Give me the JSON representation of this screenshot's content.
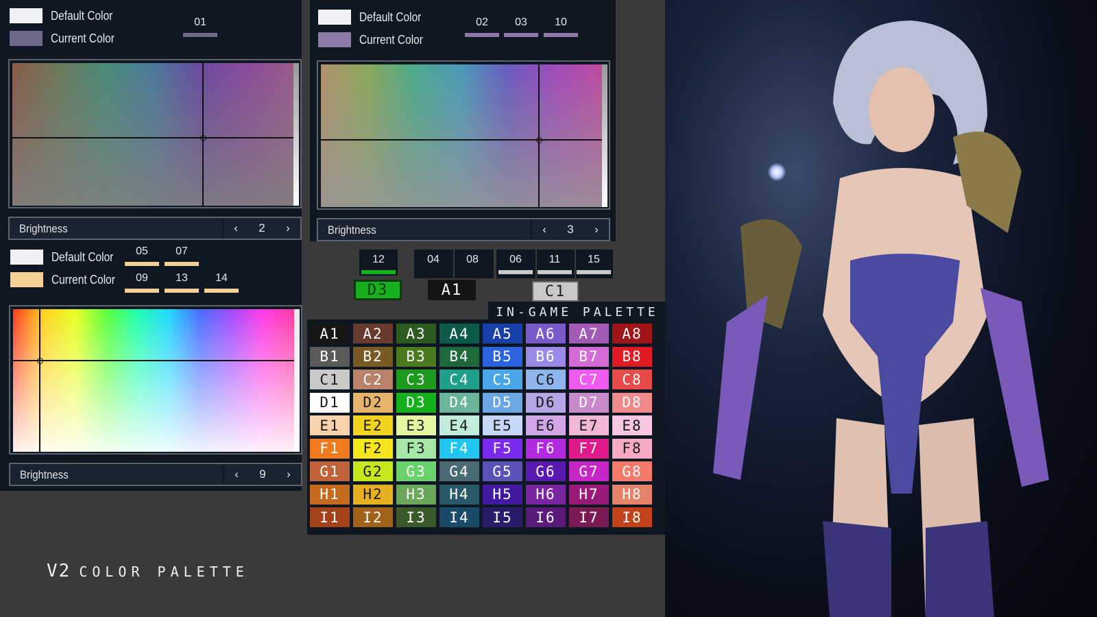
{
  "labels": {
    "default_color": "Default Color",
    "current_color": "Current Color",
    "brightness": "Brightness",
    "prev": "‹",
    "next": "›"
  },
  "pickers": [
    {
      "default_swatch": "#eef0f3",
      "current_swatch": "#6f6a8a",
      "slots": [
        {
          "num": "01",
          "color": "#6f6a8a"
        }
      ],
      "brightness": "2"
    },
    {
      "default_swatch": "#eef0f3",
      "current_swatch": "#8e79a6",
      "slots": [
        {
          "num": "02",
          "color": "#8e79a6"
        },
        {
          "num": "03",
          "color": "#8e79a6"
        },
        {
          "num": "10",
          "color": "#8e79a6"
        }
      ],
      "brightness": "3"
    },
    {
      "default_swatch": "#eef0f3",
      "current_swatch": "#f4d092",
      "slots_top": [
        {
          "num": "05",
          "color": "#f4d092"
        },
        {
          "num": "07",
          "color": "#f4d092"
        }
      ],
      "slots_bottom": [
        {
          "num": "09",
          "color": "#f4d092"
        },
        {
          "num": "13",
          "color": "#f4d092"
        },
        {
          "num": "14",
          "color": "#f4d092"
        }
      ],
      "brightness": "9"
    }
  ],
  "selected_groups": [
    {
      "slots": [
        {
          "num": "12",
          "color": "#16b01e"
        }
      ],
      "chip": "D3",
      "chip_color": "#16b01e"
    },
    {
      "slots": [
        {
          "num": "04",
          "color": "#0e1722"
        },
        {
          "num": "08",
          "color": "#0e1722"
        }
      ],
      "chip": "A1",
      "chip_color": "#141414"
    },
    {
      "slots": [
        {
          "num": "06",
          "color": "#c9c9c9"
        },
        {
          "num": "11",
          "color": "#c9c9c9"
        },
        {
          "num": "15",
          "color": "#c9c9c9"
        }
      ],
      "chip": "C1",
      "chip_color": "#c9c9c9"
    }
  ],
  "palette": {
    "title": "IN-GAME PALETTE",
    "rows": [
      [
        {
          "id": "A1",
          "color": "#161616"
        },
        {
          "id": "A2",
          "color": "#6b3a2e"
        },
        {
          "id": "A3",
          "color": "#2d5a1e"
        },
        {
          "id": "A4",
          "color": "#0e5a4a"
        },
        {
          "id": "A5",
          "color": "#1a3fa8"
        },
        {
          "id": "A6",
          "color": "#7a5ac8"
        },
        {
          "id": "A7",
          "color": "#a25ab4"
        },
        {
          "id": "A8",
          "color": "#a11418"
        }
      ],
      [
        {
          "id": "B1",
          "color": "#5a5a5a"
        },
        {
          "id": "B2",
          "color": "#7a5a24"
        },
        {
          "id": "B3",
          "color": "#4a7a1e"
        },
        {
          "id": "B4",
          "color": "#1e6a3a"
        },
        {
          "id": "B5",
          "color": "#2a62e0"
        },
        {
          "id": "B6",
          "color": "#9a8ae6"
        },
        {
          "id": "B7",
          "color": "#d46ad4"
        },
        {
          "id": "B8",
          "color": "#e21a24"
        }
      ],
      [
        {
          "id": "C1",
          "color": "#c9c9c9"
        },
        {
          "id": "C2",
          "color": "#b8826a"
        },
        {
          "id": "C3",
          "color": "#1e9a1e"
        },
        {
          "id": "C4",
          "color": "#1ea08a"
        },
        {
          "id": "C5",
          "color": "#4aa6e6"
        },
        {
          "id": "C6",
          "color": "#8eb6ec"
        },
        {
          "id": "C7",
          "color": "#ee5aee"
        },
        {
          "id": "C8",
          "color": "#e84a4a"
        }
      ],
      [
        {
          "id": "D1",
          "color": "#ffffff"
        },
        {
          "id": "D2",
          "color": "#e4b46a"
        },
        {
          "id": "D3",
          "color": "#16b01e"
        },
        {
          "id": "D4",
          "color": "#6ab49a"
        },
        {
          "id": "D5",
          "color": "#6aa6e4"
        },
        {
          "id": "D6",
          "color": "#b6a6e6"
        },
        {
          "id": "D7",
          "color": "#c88ac8"
        },
        {
          "id": "D8",
          "color": "#f08a8a"
        }
      ],
      [
        {
          "id": "E1",
          "color": "#f8d2aa"
        },
        {
          "id": "E2",
          "color": "#f0d41e"
        },
        {
          "id": "E3",
          "color": "#e4f6a2"
        },
        {
          "id": "E4",
          "color": "#c2ecda"
        },
        {
          "id": "E5",
          "color": "#c6d6f6"
        },
        {
          "id": "E6",
          "color": "#d0a6e6"
        },
        {
          "id": "E7",
          "color": "#f0b6d6"
        },
        {
          "id": "E8",
          "color": "#f8c6e2"
        }
      ],
      [
        {
          "id": "F1",
          "color": "#f07a1e"
        },
        {
          "id": "F2",
          "color": "#f6e61e"
        },
        {
          "id": "F3",
          "color": "#a6e6a6"
        },
        {
          "id": "F4",
          "color": "#1ec6f0"
        },
        {
          "id": "F5",
          "color": "#7a2aee"
        },
        {
          "id": "F6",
          "color": "#b22ae0"
        },
        {
          "id": "F7",
          "color": "#e01a8a"
        },
        {
          "id": "F8",
          "color": "#f6aac6"
        }
      ],
      [
        {
          "id": "G1",
          "color": "#c0623a"
        },
        {
          "id": "G2",
          "color": "#c6e61e"
        },
        {
          "id": "G3",
          "color": "#6ad26a"
        },
        {
          "id": "G4",
          "color": "#4a6a74"
        },
        {
          "id": "G5",
          "color": "#5a52b6"
        },
        {
          "id": "G6",
          "color": "#5a1ab2"
        },
        {
          "id": "G7",
          "color": "#c626c6"
        },
        {
          "id": "G8",
          "color": "#f67a6a"
        }
      ],
      [
        {
          "id": "H1",
          "color": "#c66a1e"
        },
        {
          "id": "H2",
          "color": "#e6b01e"
        },
        {
          "id": "H3",
          "color": "#6aa65a"
        },
        {
          "id": "H4",
          "color": "#2a5a6a"
        },
        {
          "id": "H5",
          "color": "#421aa2"
        },
        {
          "id": "H6",
          "color": "#7a26a2"
        },
        {
          "id": "H7",
          "color": "#9a1a7a"
        },
        {
          "id": "H8",
          "color": "#e6826a"
        }
      ],
      [
        {
          "id": "I1",
          "color": "#a6421a"
        },
        {
          "id": "I2",
          "color": "#a2621a"
        },
        {
          "id": "I3",
          "color": "#3a5a2a"
        },
        {
          "id": "I4",
          "color": "#1a4a6a"
        },
        {
          "id": "I5",
          "color": "#2a1a6a"
        },
        {
          "id": "I6",
          "color": "#5a1a7a"
        },
        {
          "id": "I7",
          "color": "#7a1a52"
        },
        {
          "id": "I8",
          "color": "#c2421a"
        }
      ]
    ]
  },
  "footer": {
    "version": "V2",
    "title": "COLOR PALETTE"
  }
}
